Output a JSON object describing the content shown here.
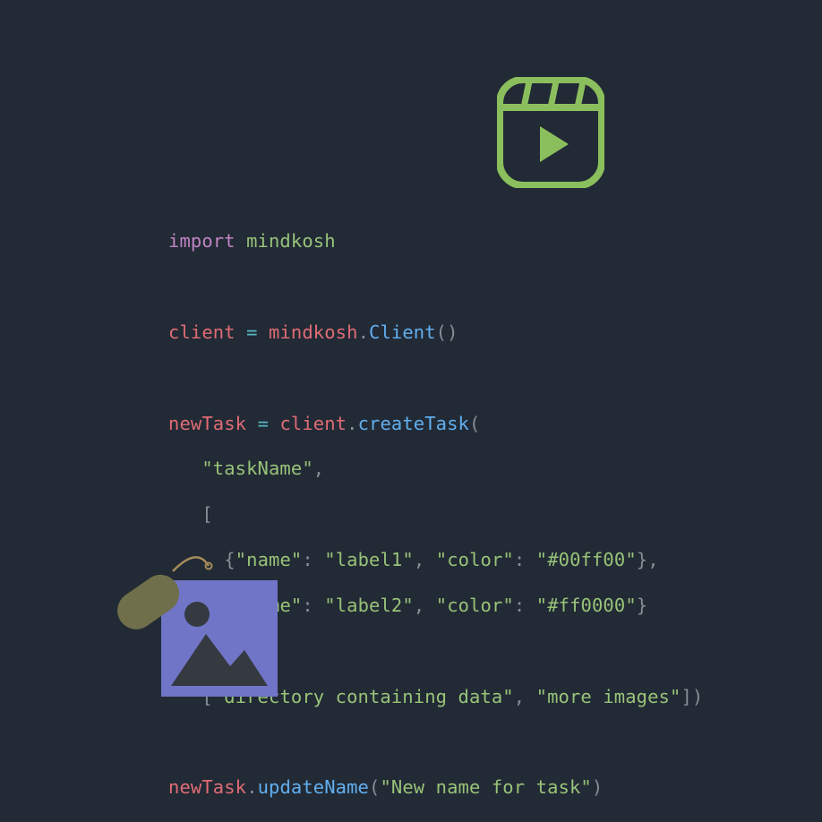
{
  "code": {
    "l1": {
      "kw": "import",
      "sp": " ",
      "mod": "mindkosh"
    },
    "l2": {
      "var": "client",
      "sp1": " ",
      "op": "=",
      "sp2": " ",
      "mod": "mindkosh",
      "dot": ".",
      "fn": "Client",
      "lp": "(",
      "rp": ")"
    },
    "l3": {
      "var": "newTask",
      "sp1": " ",
      "op": "=",
      "sp2": " ",
      "client": "client",
      "dot": ".",
      "fn": "createTask",
      "lp": "("
    },
    "l4": {
      "indent": "   ",
      "q1": "\"",
      "str": "taskName",
      "q2": "\"",
      "comma": ","
    },
    "l5": {
      "indent": "   ",
      "lb": "["
    },
    "l6": {
      "indent": "     ",
      "lb": "{",
      "q1": "\"",
      "k1": "name",
      "q2": "\"",
      "col1": ":",
      "sp1": " ",
      "q3": "\"",
      "v1": "label1",
      "q4": "\"",
      "comma1": ",",
      "sp2": " ",
      "q5": "\"",
      "k2": "color",
      "q6": "\"",
      "col2": ":",
      "sp3": " ",
      "q7": "\"",
      "v2": "#00ff00",
      "q8": "\"",
      "rb": "}",
      "comma2": ","
    },
    "l7": {
      "indent": "     ",
      "lb": "{",
      "q1": "\"",
      "k1": "name",
      "q2": "\"",
      "col1": ":",
      "sp1": " ",
      "q3": "\"",
      "v1": "label2",
      "q4": "\"",
      "comma1": ",",
      "sp2": " ",
      "q5": "\"",
      "k2": "color",
      "q6": "\"",
      "col2": ":",
      "sp3": " ",
      "q7": "\"",
      "v2": "#ff0000",
      "q8": "\"",
      "rb": "}"
    },
    "l8": {
      "indent": "   ",
      "rb": "]",
      "comma": ","
    },
    "l9": {
      "indent": "   ",
      "lb": "[",
      "q1": "\"",
      "s1": "directory containing data",
      "q2": "\"",
      "comma": ",",
      "sp": " ",
      "q3": "\"",
      "s2": "more images",
      "q4": "\"",
      "rb": "]",
      "rp": ")"
    },
    "l10": {
      "var": "newTask",
      "dot": ".",
      "fn": "updateName",
      "lp": "(",
      "q1": "\"",
      "str": "New name for task",
      "q2": "\"",
      "rp": ")"
    }
  },
  "colors": {
    "bg": "#222a35",
    "keyword": "#c084c4",
    "module": "#98c379",
    "variable": "#e06c75",
    "operator": "#56b6c2",
    "function": "#61afef",
    "punct": "#868e96",
    "string": "#98c379",
    "icon_green": "#8bbf5e",
    "icon_purple": "#7075c7",
    "icon_dark": "#343a40",
    "tag_olive": "#6f6f4b"
  }
}
